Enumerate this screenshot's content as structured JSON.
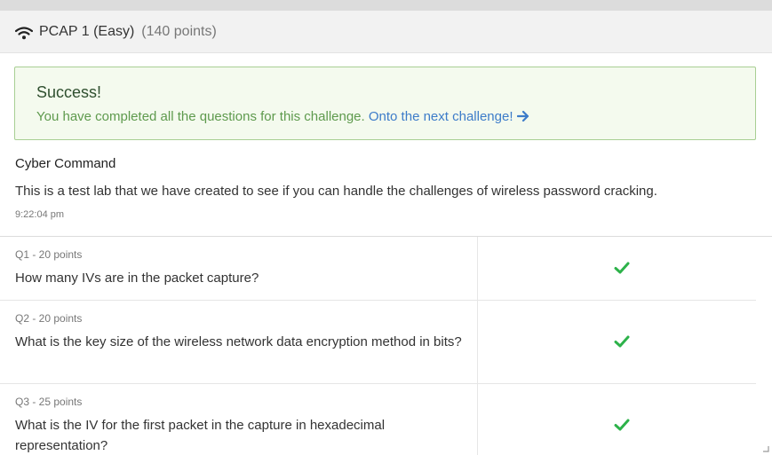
{
  "header": {
    "title": "PCAP 1 (Easy)",
    "points": "(140 points)",
    "icon": "wifi-icon"
  },
  "alert": {
    "title": "Success!",
    "text": "You have completed all the questions for this challenge.",
    "link_text": "Onto the next challenge!",
    "link_icon": "arrow-right-icon",
    "colors": {
      "background": "#f4faee",
      "border": "#a8cf93",
      "text": "#5e9a4d",
      "link": "#3d7cc9"
    }
  },
  "challenge": {
    "author": "Cyber Command",
    "description": "This is a test lab that we have created to see if you can handle the challenges of wireless password cracking.",
    "time": "9:22:04 pm"
  },
  "questions": [
    {
      "meta": "Q1 - 20 points",
      "text": "How many IVs are in the packet capture?",
      "status_icon": "check-icon"
    },
    {
      "meta": "Q2 - 20 points",
      "text": "What is the key size of the wireless network data encryption method in bits?",
      "status_icon": "check-icon"
    },
    {
      "meta": "Q3 - 25 points",
      "text": "What is the IV for the first packet in the capture in hexadecimal representation?",
      "status_icon": "check-icon"
    }
  ],
  "colors": {
    "check": "#2db24a"
  }
}
